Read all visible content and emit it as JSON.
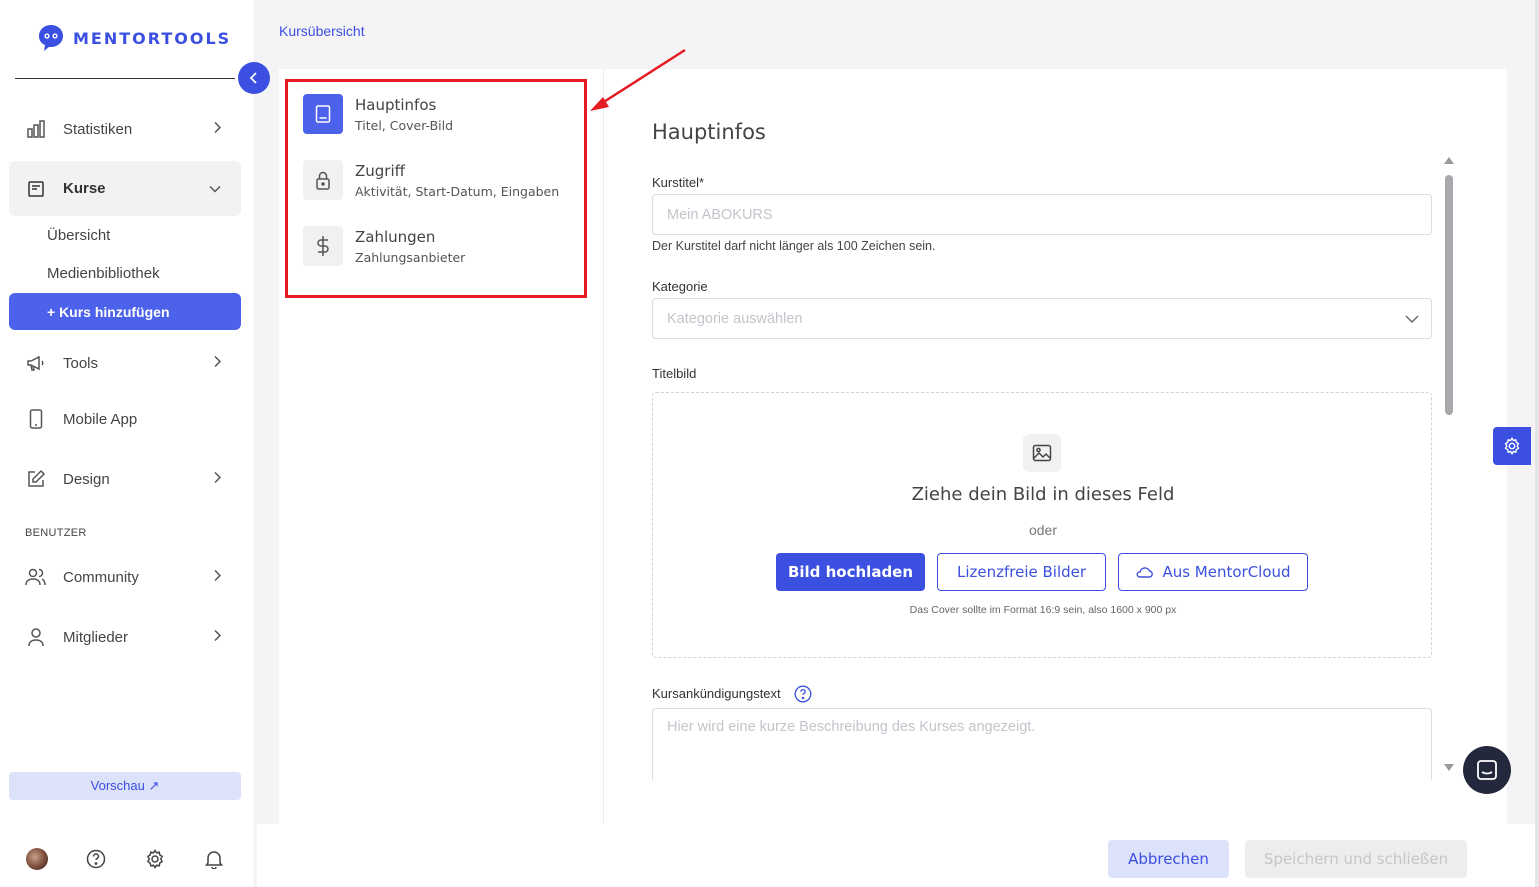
{
  "brand": {
    "name": "MENTORTOOLS"
  },
  "sidebar": {
    "items": [
      {
        "label": "Statistiken",
        "icon": "bar-chart-icon"
      },
      {
        "label": "Kurse",
        "icon": "book-icon"
      },
      {
        "label": "Tools",
        "icon": "megaphone-icon"
      },
      {
        "label": "Mobile App",
        "icon": "phone-icon"
      },
      {
        "label": "Design",
        "icon": "pencil-icon"
      },
      {
        "label": "Community",
        "icon": "users-icon"
      },
      {
        "label": "Mitglieder",
        "icon": "user-icon"
      }
    ],
    "kurse_sub": [
      "Übersicht",
      "Medienbibliothek"
    ],
    "add_course": "+ Kurs hinzufügen",
    "section_users": "BENUTZER",
    "preview": "Vorschau ↗"
  },
  "breadcrumb": "Kursübersicht",
  "steps": [
    {
      "title": "Hauptinfos",
      "subtitle": "Titel, Cover-Bild",
      "icon": "book-icon",
      "active": true
    },
    {
      "title": "Zugriff",
      "subtitle": "Aktivität, Start-Datum, Eingaben",
      "icon": "lock-icon",
      "active": false
    },
    {
      "title": "Zahlungen",
      "subtitle": "Zahlungsanbieter",
      "icon": "dollar-icon",
      "active": false
    }
  ],
  "form": {
    "heading": "Hauptinfos",
    "course_title_label": "Kurstitel*",
    "course_title_placeholder": "Mein ABOKURS",
    "course_title_hint": "Der Kurstitel darf nicht länger als 100 Zeichen sein.",
    "category_label": "Kategorie",
    "category_placeholder": "Kategorie auswählen",
    "cover_label": "Titelbild",
    "dropzone_title": "Ziehe dein Bild in dieses Feld",
    "dropzone_or": "oder",
    "upload_button": "Bild hochladen",
    "free_images_button": "Lizenzfreie Bilder",
    "cloud_button": "Aus MentorCloud",
    "cover_note": "Das Cover sollte im Format 16:9 sein, also 1600 x 900 px",
    "announcement_label": "Kursankündigungstext",
    "announcement_placeholder": "Hier wird eine kurze Beschreibung des Kurses angezeigt."
  },
  "footer": {
    "cancel": "Abbrechen",
    "save": "Speichern und schließen"
  },
  "colors": {
    "accent": "#3b4fe0",
    "highlight": "#e51c23"
  }
}
